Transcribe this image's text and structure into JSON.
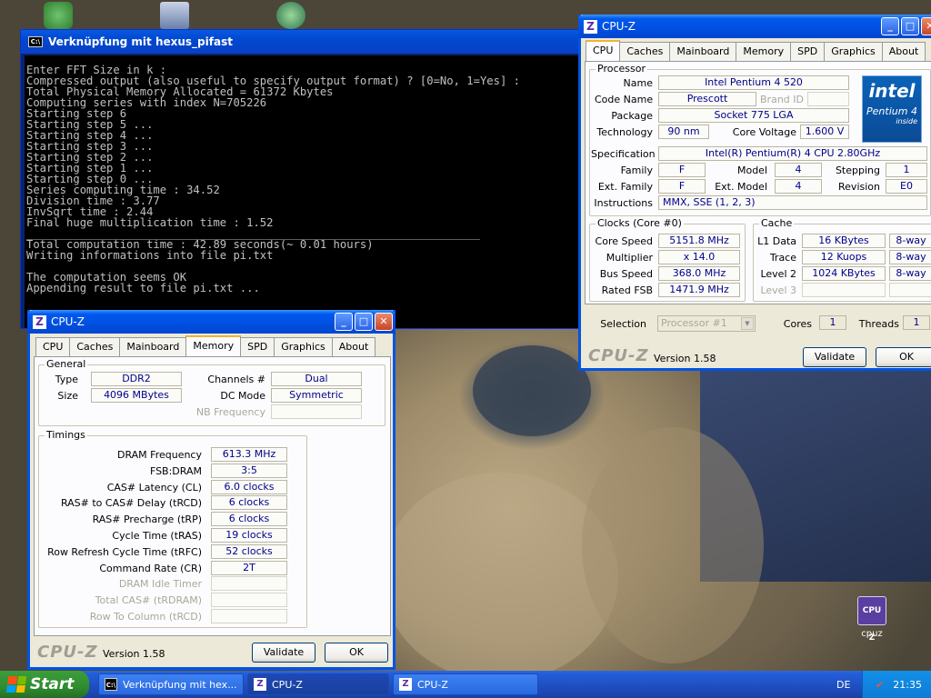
{
  "console": {
    "title": "Verknüpfung mit hexus_pifast",
    "lines": [
      "Enter FFT Size in k :",
      "Compressed output (also useful to specify output format) ? [0=No, 1=Yes] :",
      "Total Physical Memory Allocated = 61372 Kbytes",
      "Computing series with index N=705226",
      "Starting step 6",
      "Starting step 5 ...",
      "Starting step 4 ...",
      "Starting step 3 ...",
      "Starting step 2 ...",
      "Starting step 1 ...",
      "Starting step 0 ...",
      "Series computing time : 34.52",
      "Division time : 3.77",
      "InvSqrt time : 2.44",
      "Final huge multiplication time : 1.52",
      "____________________________________________________________________",
      "Total computation time : 42.89 seconds(~ 0.01 hours)",
      "Writing informations into file pi.txt",
      "",
      "The computation seems OK",
      "Appending result to file pi.txt ..."
    ]
  },
  "cpuz_cpu": {
    "title": "CPU-Z",
    "tabs": [
      "CPU",
      "Caches",
      "Mainboard",
      "Memory",
      "SPD",
      "Graphics",
      "About"
    ],
    "active_tab": "CPU",
    "processor_group": "Processor",
    "name_label": "Name",
    "name": "Intel Pentium 4 520",
    "codename_label": "Code Name",
    "codename": "Prescott",
    "brandid_label": "Brand ID",
    "brandid": "",
    "package_label": "Package",
    "package": "Socket 775 LGA",
    "technology_label": "Technology",
    "technology": "90 nm",
    "voltage_label": "Core Voltage",
    "voltage": "1.600 V",
    "spec_label": "Specification",
    "spec": "Intel(R) Pentium(R) 4 CPU 2.80GHz",
    "family_label": "Family",
    "family": "F",
    "model_label": "Model",
    "model": "4",
    "stepping_label": "Stepping",
    "stepping": "1",
    "extfamily_label": "Ext. Family",
    "extfamily": "F",
    "extmodel_label": "Ext. Model",
    "extmodel": "4",
    "revision_label": "Revision",
    "revision": "E0",
    "instructions_label": "Instructions",
    "instructions": "MMX, SSE (1, 2, 3)",
    "clocks_group": "Clocks (Core #0)",
    "corespeed_label": "Core Speed",
    "corespeed": "5151.8 MHz",
    "multiplier_label": "Multiplier",
    "multiplier": "x 14.0",
    "busspeed_label": "Bus Speed",
    "busspeed": "368.0 MHz",
    "ratedfsb_label": "Rated FSB",
    "ratedfsb": "1471.9 MHz",
    "cache_group": "Cache",
    "l1_label": "L1 Data",
    "l1": "16 KBytes",
    "l1_way": "8-way",
    "trace_label": "Trace",
    "trace": "12 Kuops",
    "trace_way": "8-way",
    "l2_label": "Level 2",
    "l2": "1024 KBytes",
    "l2_way": "8-way",
    "l3_label": "Level 3",
    "l3": "",
    "l3_way": "",
    "selection_label": "Selection",
    "selection": "Processor #1",
    "cores_label": "Cores",
    "cores": "1",
    "threads_label": "Threads",
    "threads": "1",
    "brand": "CPU-Z",
    "version": "Version 1.58",
    "validate": "Validate",
    "ok": "OK",
    "intel_logo": {
      "line1": "intel",
      "line2": "Pentium 4",
      "line3": "inside"
    }
  },
  "cpuz_mem": {
    "title": "CPU-Z",
    "tabs": [
      "CPU",
      "Caches",
      "Mainboard",
      "Memory",
      "SPD",
      "Graphics",
      "About"
    ],
    "active_tab": "Memory",
    "general_group": "General",
    "type_label": "Type",
    "type": "DDR2",
    "size_label": "Size",
    "size": "4096 MBytes",
    "channels_label": "Channels #",
    "channels": "Dual",
    "dcmode_label": "DC Mode",
    "dcmode": "Symmetric",
    "nbfreq_label": "NB Frequency",
    "nbfreq": "",
    "timings_group": "Timings",
    "timings": [
      {
        "label": "DRAM Frequency",
        "value": "613.3 MHz",
        "enabled": true
      },
      {
        "label": "FSB:DRAM",
        "value": "3:5",
        "enabled": true
      },
      {
        "label": "CAS# Latency (CL)",
        "value": "6.0 clocks",
        "enabled": true
      },
      {
        "label": "RAS# to CAS# Delay (tRCD)",
        "value": "6 clocks",
        "enabled": true
      },
      {
        "label": "RAS# Precharge (tRP)",
        "value": "6 clocks",
        "enabled": true
      },
      {
        "label": "Cycle Time (tRAS)",
        "value": "19 clocks",
        "enabled": true
      },
      {
        "label": "Row Refresh Cycle Time (tRFC)",
        "value": "52 clocks",
        "enabled": true
      },
      {
        "label": "Command Rate (CR)",
        "value": "2T",
        "enabled": true
      },
      {
        "label": "DRAM Idle Timer",
        "value": "",
        "enabled": false
      },
      {
        "label": "Total CAS# (tRDRAM)",
        "value": "",
        "enabled": false
      },
      {
        "label": "Row To Column (tRCD)",
        "value": "",
        "enabled": false
      }
    ],
    "brand": "CPU-Z",
    "version": "Version 1.58",
    "validate": "Validate",
    "ok": "OK"
  },
  "desktop": {
    "cpuz_icon_label": "cpuz",
    "cpuz_icon_text": "CPU Z"
  },
  "taskbar": {
    "start": "Start",
    "tasks": [
      "Verknüpfung mit hex...",
      "CPU-Z",
      "CPU-Z"
    ],
    "language": "DE",
    "clock": "21:35"
  }
}
